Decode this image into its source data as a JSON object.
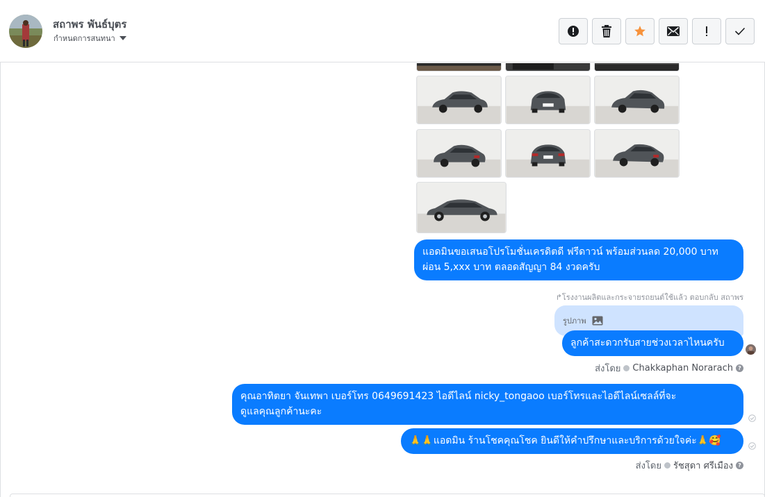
{
  "header": {
    "contact_name": "สถาพร พันธ์บุตร",
    "assign_label": "กำหนดการสนทนา",
    "actions": [
      {
        "name": "spam-button",
        "icon": "alert-circle-icon"
      },
      {
        "name": "delete-button",
        "icon": "trash-icon"
      },
      {
        "name": "star-button",
        "icon": "star-icon"
      },
      {
        "name": "mark-unread-button",
        "icon": "envelope-icon"
      },
      {
        "name": "follow-up-button",
        "icon": "exclamation-icon"
      },
      {
        "name": "mark-done-button",
        "icon": "checkmark-icon"
      }
    ]
  },
  "colors": {
    "bubble": "#0a7cff",
    "quote": "#cfe3ff",
    "star": "#f7923b",
    "muted_text": "#90949c"
  },
  "thread": {
    "message_offer": {
      "line1": "แอดมินขอเสนอโปรโมชั่นเครดิตดี ฟรีดาวน์ พร้อมส่วนลด 20,000 บาท",
      "line2": "ผ่อน 5,xxx บาท ตลอดสัญญา 84 งวดครับ"
    },
    "reply_meta": "↱โรงงานผลิตและกระจายรถยนต์ใช้แล้ว ตอบกลับ สถาพร",
    "quoted_label": "รูปภาพ",
    "message_ask": "ลูกค้าสะดวกรับสายช่วงเวลาไหนครับ",
    "sent_by_1": {
      "label": "ส่งโดย",
      "name": "Chakkaphan Norarach"
    },
    "message_contact": {
      "line1": "คุณอาทิตยา จันเทพา     เบอร์โทร 0649691423  ไอดีไลน์ nicky_tongaoo   เบอร์โทรและไอดีไลน์เซลล์ที่จะ",
      "line2": "ดูแลคุณลูกค้านะคะ"
    },
    "message_thanks": "🙏🙏แอดมิน ร้านโชคคุณโชค ยินดีให้คำปรึกษาและบริการด้วยใจค่ะ🙏🥰",
    "sent_by_2": {
      "label": "ส่งโดย",
      "name": "รัชสุดา ศรีเมือง"
    }
  }
}
